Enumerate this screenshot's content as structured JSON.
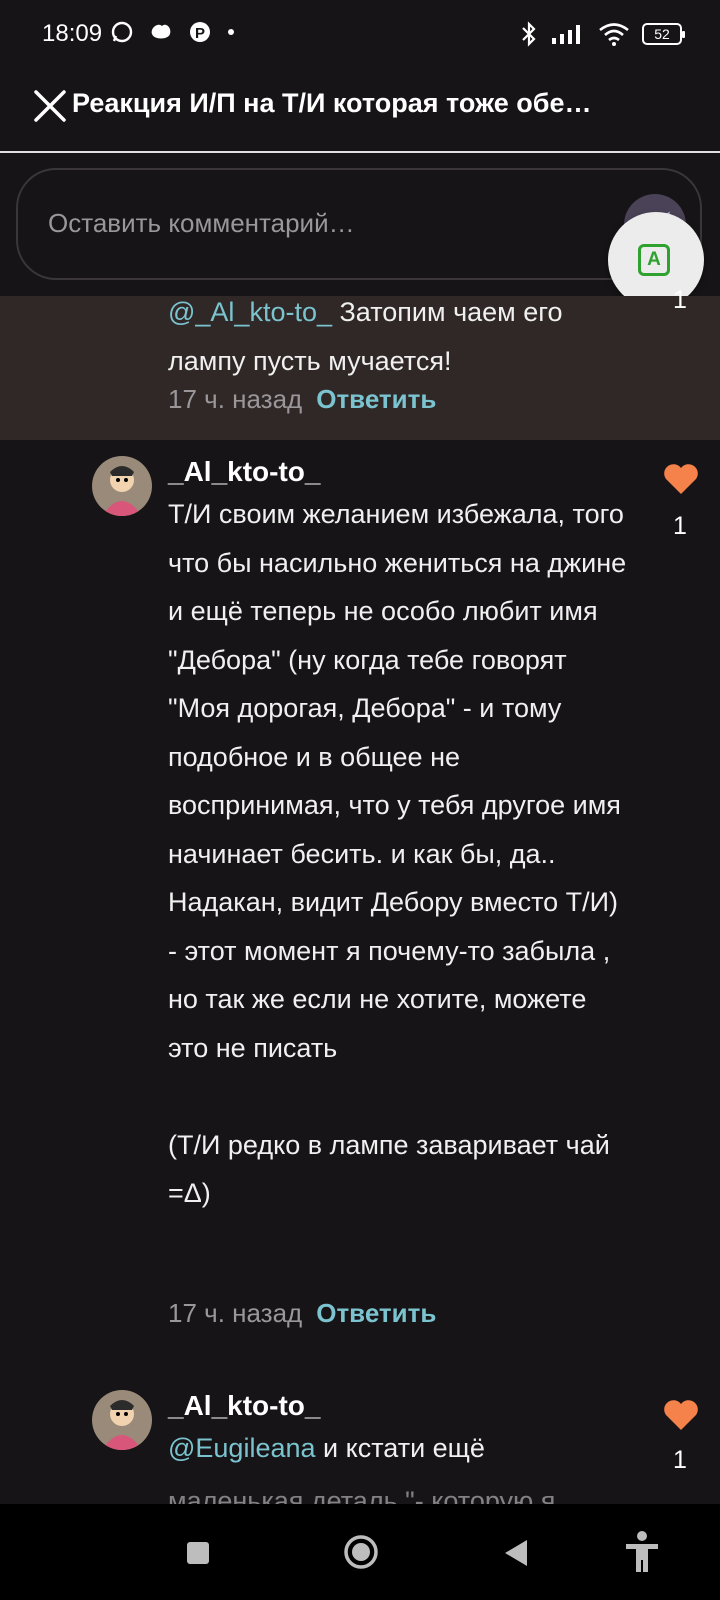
{
  "status_bar": {
    "time": "18:09",
    "battery": "52",
    "icons_left": [
      "whatsapp-icon",
      "app-icon",
      "pinterest-icon",
      "dot-icon"
    ],
    "icons_right": [
      "bluetooth-icon",
      "signal-icon",
      "wifi-icon",
      "battery-icon"
    ]
  },
  "header": {
    "title": "Реакция И/П на Т/И которая тоже обе…",
    "close_icon": "close-icon"
  },
  "comment_input": {
    "placeholder": "Оставить комментарий…",
    "send_icon": "send-icon",
    "translate_icon": "translate-icon",
    "translate_label": "A"
  },
  "comments": [
    {
      "mention": "@_Al_kto-to_",
      "text": " Затопим чаем его лампу пусть мучается!",
      "time": "17 ч. назад",
      "reply_label": "Ответить",
      "likes": "1"
    },
    {
      "author": "_Al_kto-to_",
      "text": "Т/И своим желанием избежала, того что бы насильно жениться на джине и ещё теперь не особо любит имя \"Дебора\" (ну когда тебе говорят \"Моя дорогая, Дебора\" - и тому подобное и в общее не воспринимая, что у тебя другое имя начинает бесить. и как бы, да.. Надакан, видит Дебору вместо Т/И) - этот момент я почему-то забыла , но так же если не хотите, можете это не писать\n\n(Т/И редко в лампе заваривает чай =Δ)",
      "time": "17 ч. назад",
      "reply_label": "Ответить",
      "likes": "1"
    },
    {
      "author": "_Al_kto-to_",
      "mention": "@Eugileana",
      "text": " и кстати ещё",
      "likes": "1",
      "cut_text": "маленькая деталь \"- которую я"
    }
  ],
  "nav_bar": {
    "icons": [
      "recent-apps-icon",
      "home-icon",
      "back-icon",
      "accessibility-icon"
    ]
  },
  "colors": {
    "background": "#161416",
    "highlight": "#2f2826",
    "link": "#7bc3cf",
    "heart": "#f5824a"
  }
}
